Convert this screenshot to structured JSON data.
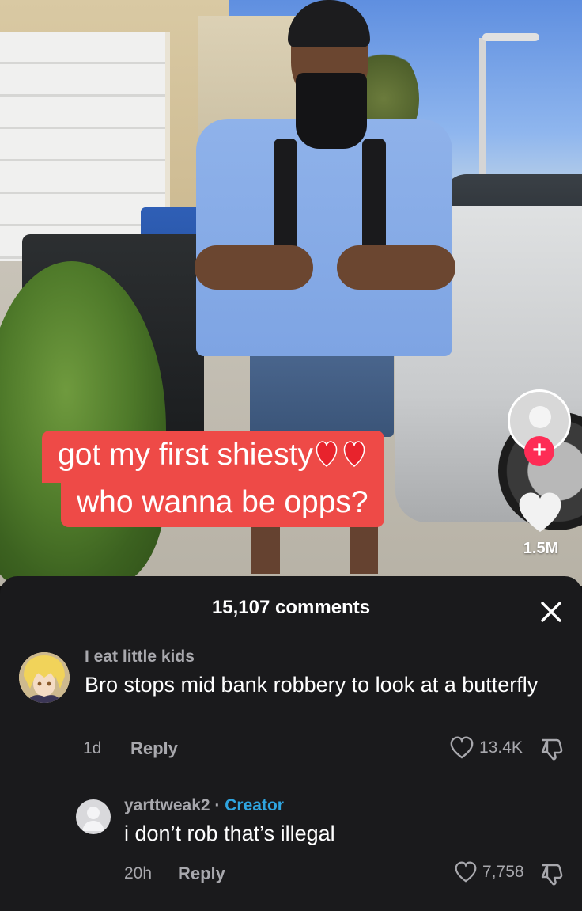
{
  "video": {
    "caption_line1": "got my first shiesty",
    "caption_line1_emoji": "❤️❤️",
    "caption_line2": "who wanna be opps?",
    "like_count": "1.5M",
    "follow_symbol": "+"
  },
  "comments_sheet": {
    "title": "15,107 comments",
    "close_symbol": "✕",
    "comments": [
      {
        "username": "I eat little kids",
        "text": "Bro stops mid bank robbery to look at a butterfly",
        "time": "1d",
        "reply_label": "Reply",
        "likes": "13.4K"
      },
      {
        "username": "yarttweak2",
        "separator": "·",
        "badge": "Creator",
        "text": "i don’t rob that’s illegal",
        "time": "20h",
        "reply_label": "Reply",
        "likes": "7,758"
      }
    ]
  },
  "colors": {
    "caption_bg": "#ee4a47",
    "follow_red": "#fe2c55",
    "creator_blue": "#2fa5e0",
    "sheet_bg": "#1a1a1c"
  },
  "icons": [
    "heart-icon",
    "close-icon",
    "dislike-icon",
    "plus-icon"
  ]
}
